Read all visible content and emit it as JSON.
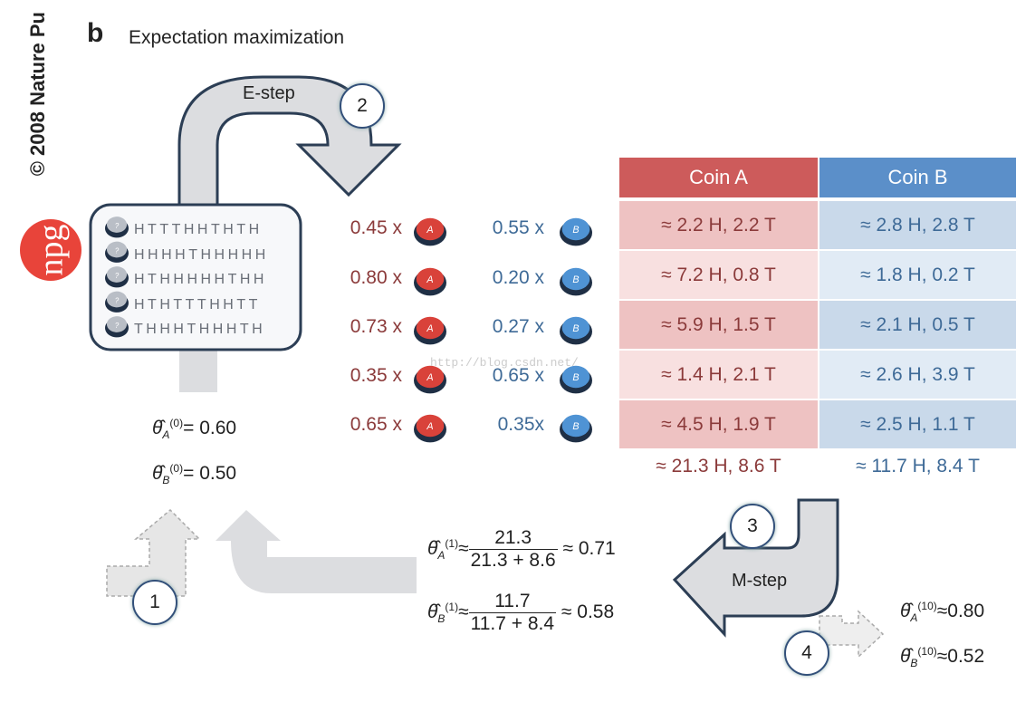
{
  "panel_label": "b",
  "title": "Expectation maximization",
  "copyright": "© 2008 Nature Pu",
  "logo_text": "npg",
  "e_step_label": "E-step",
  "m_step_label": "M-step",
  "step_numbers": [
    "1",
    "2",
    "3",
    "4"
  ],
  "sequences": [
    "HTTTHHTHTH",
    "HHHHTHHHHH",
    "HTHHHHHTHH",
    "HTHTTTHHTT",
    "THHHTHHHTH"
  ],
  "coin_icon_label_unknown": "?",
  "coin_a_icon_label": "A",
  "coin_b_icon_label": "B",
  "weights_a": [
    "0.45 x",
    "0.80 x",
    "0.73 x",
    "0.35 x",
    "0.65 x"
  ],
  "weights_b": [
    "0.55 x",
    "0.20 x",
    "0.27 x",
    "0.65 x",
    "0.35x"
  ],
  "table": {
    "headers": [
      "Coin A",
      "Coin B"
    ],
    "rows": [
      [
        "≈ 2.2 H, 2.2 T",
        "≈ 2.8 H, 2.8 T"
      ],
      [
        "≈ 7.2 H, 0.8 T",
        "≈ 1.8 H, 0.2 T"
      ],
      [
        "≈ 5.9 H, 1.5 T",
        "≈ 2.1 H, 0.5 T"
      ],
      [
        "≈ 1.4 H, 2.1 T",
        "≈ 2.6 H, 3.9 T"
      ],
      [
        "≈ 4.5 H, 1.9 T",
        "≈ 2.5 H, 1.1 T"
      ]
    ],
    "totals": [
      "≈ 21.3 H, 8.6 T",
      "≈ 11.7 H, 8.4 T"
    ]
  },
  "initial": {
    "a_sup": "(0)",
    "a_sub": "A",
    "a_val": "= 0.60",
    "b_sup": "(0)",
    "b_sub": "B",
    "b_val": "= 0.50"
  },
  "update": {
    "a_sup": "(1)",
    "a_sub": "A",
    "a_num": "21.3",
    "a_den": "21.3 + 8.6",
    "a_val": "≈ 0.71",
    "b_sup": "(1)",
    "b_sub": "B",
    "b_num": "11.7",
    "b_den": "11.7 + 8.4",
    "b_val": "≈ 0.58"
  },
  "final": {
    "a_sup": "(10)",
    "a_sub": "A",
    "a_val": "≈0.80",
    "b_sup": "(10)",
    "b_sub": "B",
    "b_val": "≈0.52"
  },
  "watermark": "http://blog.csdn.net/",
  "colors": {
    "coin_a_header": "#cd5b5b",
    "coin_b_header": "#5b8fc9",
    "coin_a_text": "#8b3a3a",
    "coin_b_text": "#3e6a97",
    "logo": "#e8443a"
  }
}
